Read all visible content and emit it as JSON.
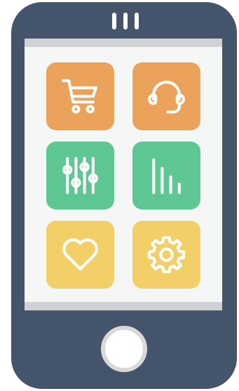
{
  "colors": {
    "phone_body": "#44546b",
    "screen": "#f5f6f6",
    "screen_bars": "#cfd2d4",
    "speaker": "#ffffff",
    "home_button": "#ffffff",
    "home_ring": "#d9d9d9",
    "icon_stroke": "#ffffff"
  },
  "tiles": [
    {
      "name": "shopping-cart",
      "icon": "cart-icon",
      "color": "#eba25a"
    },
    {
      "name": "customer-support",
      "icon": "headset-icon",
      "color": "#eba25a"
    },
    {
      "name": "equalizer",
      "icon": "sliders-icon",
      "color": "#5ec794"
    },
    {
      "name": "statistics",
      "icon": "bar-chart-icon",
      "color": "#5ec794"
    },
    {
      "name": "favorites",
      "icon": "heart-icon",
      "color": "#f2d067"
    },
    {
      "name": "settings",
      "icon": "gear-icon",
      "color": "#f2d067"
    }
  ]
}
